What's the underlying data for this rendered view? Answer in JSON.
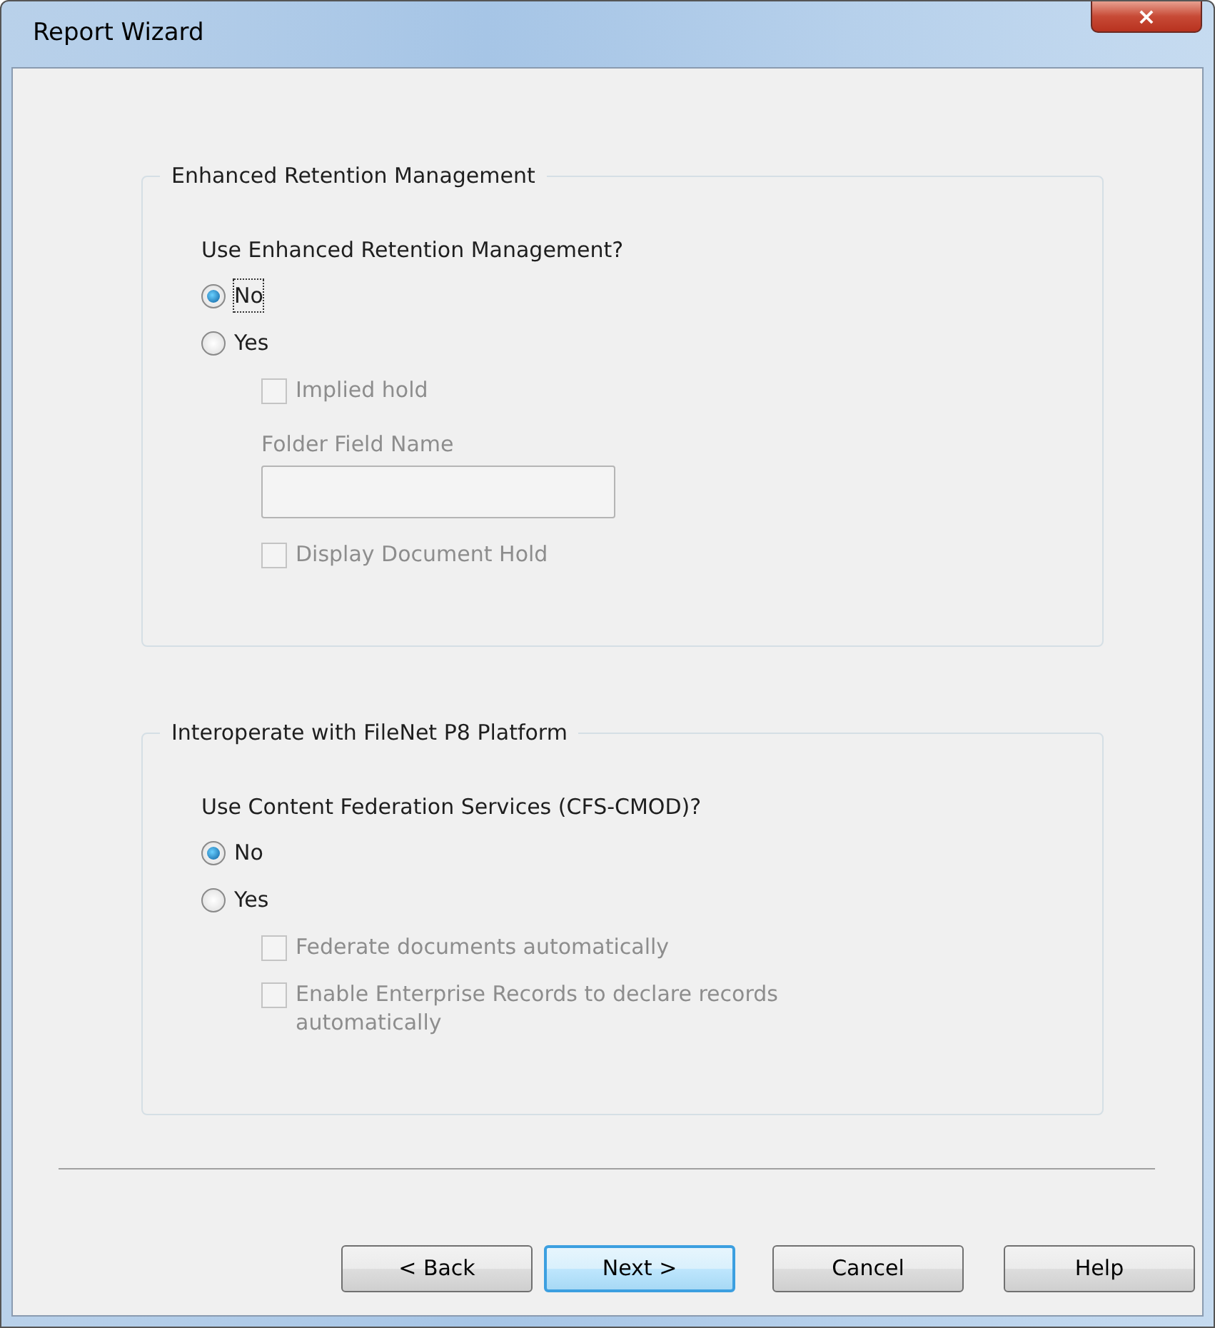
{
  "window": {
    "title": "Report Wizard",
    "close": "×"
  },
  "groups": [
    {
      "title": "Enhanced Retention Management",
      "question": "Use Enhanced Retention Management?",
      "options": [
        {
          "kind": "radio",
          "label": "No",
          "selected": true,
          "focused": true
        },
        {
          "kind": "radio",
          "label": "Yes",
          "selected": false,
          "focused": false,
          "children": [
            {
              "kind": "checkbox",
              "label": "Implied hold",
              "checked": false,
              "disabled": true
            },
            {
              "kind": "field",
              "label": "Folder Field Name",
              "disabled": true
            },
            {
              "kind": "checkbox",
              "label": "Display Document Hold",
              "checked": false,
              "disabled": true
            }
          ]
        }
      ]
    },
    {
      "title": "Interoperate with FileNet P8 Platform",
      "question": "Use Content Federation Services (CFS-CMOD)?",
      "options": [
        {
          "kind": "radio",
          "label": "No",
          "selected": true,
          "focused": false
        },
        {
          "kind": "radio",
          "label": "Yes",
          "selected": false,
          "focused": false,
          "children": [
            {
              "kind": "checkbox",
              "label": "Federate documents automatically",
              "checked": false,
              "disabled": true
            },
            {
              "kind": "checkbox",
              "label": "Enable Enterprise Records to declare records automatically",
              "checked": false,
              "disabled": true
            }
          ]
        }
      ]
    }
  ],
  "buttons": [
    {
      "label": "< Back",
      "default": false
    },
    {
      "label": "Next >",
      "default": true
    },
    {
      "label": "Cancel",
      "default": false
    },
    {
      "label": "Help",
      "default": false
    }
  ]
}
